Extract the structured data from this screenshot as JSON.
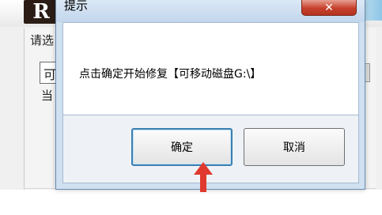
{
  "background": {
    "logo_text": "R",
    "prompt": "请选",
    "field_value": "可",
    "status": "当"
  },
  "dialog": {
    "title": "提示",
    "close_icon": "close-icon",
    "message": "点击确定开始修复【可移动磁盘G:\\】",
    "ok_label": "确定",
    "cancel_label": "取消"
  },
  "colors": {
    "close_button": "#c6402c",
    "arrow": "#e03a2f",
    "dialog_frame": "#cfe0f1"
  }
}
